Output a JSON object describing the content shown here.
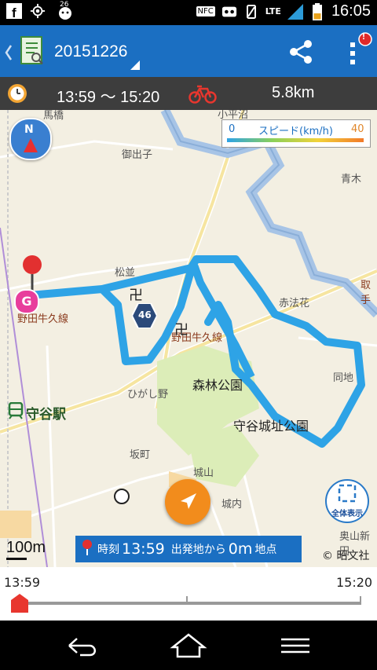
{
  "status": {
    "left_icons": [
      "facebook-icon",
      "gps-icon",
      "weather-icon"
    ],
    "weather_temp": "26",
    "nfc": "NFC",
    "network": "LTE",
    "time": "16:05"
  },
  "toolbar": {
    "title": "20151226",
    "share_icon": "share-icon",
    "menu_icon": "more-vert-icon",
    "badge": "!"
  },
  "trip": {
    "time_range": "13:59 ～ 15:20",
    "distance": "5.8km"
  },
  "speed_legend": {
    "min": "0",
    "label": "スピード(km/h)",
    "max": "40"
  },
  "map_labels": {
    "mabashi": "馬橋",
    "kodaira": "小平沼",
    "gode": "御出子",
    "aoki": "青木",
    "matsunami": "松並",
    "nodaushiku1": "野田牛久線",
    "route_num": "46",
    "nodaushiku2": "野田牛久線",
    "akahoke": "赤法花",
    "tori": "取手",
    "shinrin": "森林公園",
    "doji": "同地",
    "higashino": "ひがし野",
    "moriya_station": "守谷駅",
    "moriya_jo": "守谷城址公園",
    "sakamachi": "坂町",
    "shiroyama": "城山",
    "jonai": "城内",
    "okuyama": "奥山新田",
    "goal": "G",
    "compass": "N"
  },
  "map_controls": {
    "show_all": "全体表示",
    "scale": "100m",
    "copyright": "© 昭文社"
  },
  "time_info": {
    "prefix": "時刻",
    "time": "13:59",
    "middle": "出発地から",
    "dist": "0m",
    "suffix": "地点"
  },
  "timeline": {
    "start": "13:59",
    "end": "15:20",
    "position": 0.0
  },
  "colors": {
    "appbar": "#1b6fc2",
    "route": "#2ea3e6",
    "goal": "#e83e9c",
    "pin": "#e23030",
    "bike": "#e8362e",
    "locate_button": "#f28c1c"
  }
}
